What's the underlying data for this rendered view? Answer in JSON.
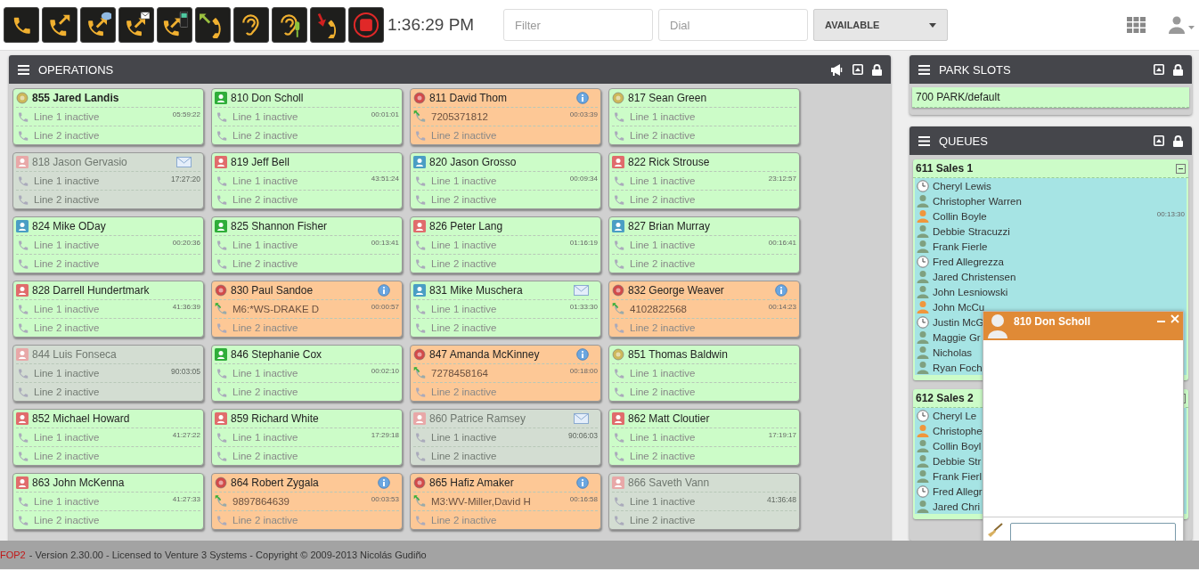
{
  "toolbar": {
    "clock": "1:36:29 PM",
    "filter": {
      "placeholder": "Filter"
    },
    "dial": {
      "placeholder": "Dial"
    },
    "presence": {
      "value": "AVAILABLE"
    }
  },
  "operations": {
    "title": "OPERATIONS",
    "extensions": [
      {
        "label": "855 Jared Landis",
        "kind": "available",
        "current_user": true,
        "icon": {
          "kind": "ring",
          "color": "#cdb85a"
        },
        "timer": "05:59:22",
        "lines": [
          {
            "text": "Line 1 inactive",
            "active": false
          },
          {
            "text": "Line 2 inactive",
            "active": false
          }
        ]
      },
      {
        "label": "810 Don Scholl",
        "kind": "available",
        "current_user": false,
        "icon": {
          "kind": "person",
          "color": "#2fae3a"
        },
        "timer": "00:01:01",
        "lines": [
          {
            "text": "Line 1 inactive",
            "active": false
          },
          {
            "text": "Line 2 inactive",
            "active": false
          }
        ]
      },
      {
        "label": "811 David Thom",
        "kind": "busy",
        "current_user": false,
        "icon": {
          "kind": "ring",
          "color": "#d24a4a"
        },
        "badge": {
          "kind": "info"
        },
        "timer": "00:03:39",
        "lines": [
          {
            "text": "7205371812",
            "active": true
          },
          {
            "text": "Line 2 inactive",
            "active": false
          }
        ]
      },
      {
        "label": "817 Sean Green",
        "kind": "available",
        "current_user": false,
        "icon": {
          "kind": "ring",
          "color": "#cdb85a"
        },
        "lines": [
          {
            "text": "Line 1 inactive",
            "active": false
          },
          {
            "text": "Line 2 inactive",
            "active": false
          }
        ]
      },
      {
        "label": "818 Jason Gervasio",
        "kind": "offline",
        "current_user": false,
        "icon": {
          "kind": "person",
          "color": "#e8a8a8"
        },
        "badge": {
          "kind": "mail"
        },
        "timer": "17:27:20",
        "lines": [
          {
            "text": "Line 1 inactive",
            "active": false
          },
          {
            "text": "Line 2 inactive",
            "active": false
          }
        ]
      },
      {
        "label": "819 Jeff Bell",
        "kind": "available",
        "current_user": false,
        "icon": {
          "kind": "person",
          "color": "#e06c6c"
        },
        "timer": "43:51:24",
        "lines": [
          {
            "text": "Line 1 inactive",
            "active": false
          },
          {
            "text": "Line 2 inactive",
            "active": false
          }
        ]
      },
      {
        "label": "820 Jason Grosso",
        "kind": "available",
        "current_user": false,
        "icon": {
          "kind": "person",
          "color": "#4a9ec4"
        },
        "timer": "00:09:34",
        "lines": [
          {
            "text": "Line 1 inactive",
            "active": false
          },
          {
            "text": "Line 2 inactive",
            "active": false
          }
        ]
      },
      {
        "label": "822 Rick Strouse",
        "kind": "available",
        "current_user": false,
        "icon": {
          "kind": "person",
          "color": "#e06c6c"
        },
        "timer": "23:12:57",
        "lines": [
          {
            "text": "Line 1 inactive",
            "active": false
          },
          {
            "text": "Line 2 inactive",
            "active": false
          }
        ]
      },
      {
        "label": "824 Mike ODay",
        "kind": "available",
        "current_user": false,
        "icon": {
          "kind": "person",
          "color": "#4a9ec4"
        },
        "timer": "00:20:36",
        "lines": [
          {
            "text": "Line 1 inactive",
            "active": false
          },
          {
            "text": "Line 2 inactive",
            "active": false
          }
        ]
      },
      {
        "label": "825 Shannon Fisher",
        "kind": "available",
        "current_user": false,
        "icon": {
          "kind": "person",
          "color": "#2fae3a"
        },
        "timer": "00:13:41",
        "lines": [
          {
            "text": "Line 1 inactive",
            "active": false
          },
          {
            "text": "Line 2 inactive",
            "active": false
          }
        ]
      },
      {
        "label": "826 Peter Lang",
        "kind": "available",
        "current_user": false,
        "icon": {
          "kind": "person",
          "color": "#e06c6c"
        },
        "timer": "01:16:19",
        "lines": [
          {
            "text": "Line 1 inactive",
            "active": false
          },
          {
            "text": "Line 2 inactive",
            "active": false
          }
        ]
      },
      {
        "label": "827 Brian Murray",
        "kind": "available",
        "current_user": false,
        "icon": {
          "kind": "person",
          "color": "#4a9ec4"
        },
        "timer": "00:16:41",
        "lines": [
          {
            "text": "Line 1 inactive",
            "active": false
          },
          {
            "text": "Line 2 inactive",
            "active": false
          }
        ]
      },
      {
        "label": "828 Darrell Hundertmark",
        "kind": "available",
        "current_user": false,
        "icon": {
          "kind": "person",
          "color": "#e06c6c"
        },
        "timer": "41:36:39",
        "lines": [
          {
            "text": "Line 1 inactive",
            "active": false
          },
          {
            "text": "Line 2 inactive",
            "active": false
          }
        ]
      },
      {
        "label": "830 Paul Sandoe",
        "kind": "busy",
        "current_user": false,
        "icon": {
          "kind": "ring",
          "color": "#d24a4a"
        },
        "badge": {
          "kind": "info"
        },
        "timer": "00:00:57",
        "lines": [
          {
            "text": "M6:*WS-DRAKE D",
            "active": true
          },
          {
            "text": "Line 2 inactive",
            "active": false
          }
        ]
      },
      {
        "label": "831 Mike Muschera",
        "kind": "available",
        "current_user": false,
        "icon": {
          "kind": "person",
          "color": "#4a9ec4"
        },
        "badge": {
          "kind": "mail"
        },
        "timer": "01:33:30",
        "lines": [
          {
            "text": "Line 1 inactive",
            "active": false
          },
          {
            "text": "Line 2 inactive",
            "active": false
          }
        ]
      },
      {
        "label": "832 George Weaver",
        "kind": "busy",
        "current_user": false,
        "icon": {
          "kind": "ring",
          "color": "#d24a4a"
        },
        "badge": {
          "kind": "info"
        },
        "timer": "00:14:23",
        "lines": [
          {
            "text": "4102822568",
            "active": true
          },
          {
            "text": "Line 2 inactive",
            "active": false
          }
        ]
      },
      {
        "label": "844 Luis Fonseca",
        "kind": "offline",
        "current_user": false,
        "icon": {
          "kind": "person",
          "color": "#e8a8a8"
        },
        "timer": "90:03:05",
        "lines": [
          {
            "text": "Line 1 inactive",
            "active": false
          },
          {
            "text": "Line 2 inactive",
            "active": false
          }
        ]
      },
      {
        "label": "846 Stephanie Cox",
        "kind": "available",
        "current_user": false,
        "icon": {
          "kind": "person",
          "color": "#2fae3a"
        },
        "timer": "00:02:10",
        "lines": [
          {
            "text": "Line 1 inactive",
            "active": false
          },
          {
            "text": "Line 2 inactive",
            "active": false
          }
        ]
      },
      {
        "label": "847 Amanda McKinney",
        "kind": "busy",
        "current_user": false,
        "icon": {
          "kind": "ring",
          "color": "#d24a4a"
        },
        "badge": {
          "kind": "info"
        },
        "timer": "00:18:00",
        "lines": [
          {
            "text": "7278458164",
            "active": true
          },
          {
            "text": "Line 2 inactive",
            "active": false
          }
        ]
      },
      {
        "label": "851 Thomas Baldwin",
        "kind": "available",
        "current_user": false,
        "icon": {
          "kind": "ring",
          "color": "#cdb85a"
        },
        "lines": [
          {
            "text": "Line 1 inactive",
            "active": false
          },
          {
            "text": "Line 2 inactive",
            "active": false
          }
        ]
      },
      {
        "label": "852 Michael Howard",
        "kind": "available",
        "current_user": false,
        "icon": {
          "kind": "person",
          "color": "#e06c6c"
        },
        "timer": "41:27:22",
        "lines": [
          {
            "text": "Line 1 inactive",
            "active": false
          },
          {
            "text": "Line 2 inactive",
            "active": false
          }
        ]
      },
      {
        "label": "859 Richard White",
        "kind": "available",
        "current_user": false,
        "icon": {
          "kind": "person",
          "color": "#e06c6c"
        },
        "timer": "17:29:18",
        "lines": [
          {
            "text": "Line 1 inactive",
            "active": false
          },
          {
            "text": "Line 2 inactive",
            "active": false
          }
        ]
      },
      {
        "label": "860 Patrice Ramsey",
        "kind": "offline",
        "current_user": false,
        "icon": {
          "kind": "person",
          "color": "#e8a8a8"
        },
        "badge": {
          "kind": "mail"
        },
        "timer": "90:06:03",
        "lines": [
          {
            "text": "Line 1 inactive",
            "active": false
          },
          {
            "text": "Line 2 inactive",
            "active": false
          }
        ]
      },
      {
        "label": "862 Matt Cloutier",
        "kind": "available",
        "current_user": false,
        "icon": {
          "kind": "person",
          "color": "#e06c6c"
        },
        "timer": "17:19:17",
        "lines": [
          {
            "text": "Line 1 inactive",
            "active": false
          },
          {
            "text": "Line 2 inactive",
            "active": false
          }
        ]
      },
      {
        "label": "863 John McKenna",
        "kind": "available",
        "current_user": false,
        "icon": {
          "kind": "person",
          "color": "#e06c6c"
        },
        "timer": "41:27:33",
        "lines": [
          {
            "text": "Line 1 inactive",
            "active": false
          },
          {
            "text": "Line 2 inactive",
            "active": false
          }
        ]
      },
      {
        "label": "864 Robert Zygala",
        "kind": "busy",
        "current_user": false,
        "icon": {
          "kind": "ring",
          "color": "#d24a4a"
        },
        "badge": {
          "kind": "info"
        },
        "timer": "00:03:53",
        "lines": [
          {
            "text": "9897864639",
            "active": true
          },
          {
            "text": "Line 2 inactive",
            "active": false
          }
        ]
      },
      {
        "label": "865 Hafiz Amaker",
        "kind": "busy",
        "current_user": false,
        "icon": {
          "kind": "ring",
          "color": "#d24a4a"
        },
        "badge": {
          "kind": "info"
        },
        "timer": "00:16:58",
        "lines": [
          {
            "text": "M3:WV-Miller,David H",
            "active": true
          },
          {
            "text": "Line 2 inactive",
            "active": false
          }
        ]
      },
      {
        "label": "866 Saveth Vann",
        "kind": "offline",
        "current_user": false,
        "icon": {
          "kind": "person",
          "color": "#e8a8a8"
        },
        "timer": "41:36:48",
        "lines": [
          {
            "text": "Line 1 inactive",
            "active": false
          },
          {
            "text": "Line 2 inactive",
            "active": false
          }
        ]
      }
    ]
  },
  "park_slots": {
    "title": "PARK SLOTS",
    "slots": [
      {
        "label": "700 PARK/default"
      }
    ]
  },
  "queues": {
    "title": "QUEUES",
    "queues": [
      {
        "name": "611 Sales 1",
        "expanded": true,
        "members": [
          {
            "name": "Cheryl Lewis",
            "kind": "clock"
          },
          {
            "name": "Christopher Warren",
            "kind": "person",
            "color": "#7fa07f"
          },
          {
            "name": "Collin Boyle",
            "kind": "person",
            "color": "#f0963c",
            "timer": "00:13:30"
          },
          {
            "name": "Debbie Stracuzzi",
            "kind": "person",
            "color": "#7fa07f"
          },
          {
            "name": "Frank Fierle",
            "kind": "person",
            "color": "#7fa07f"
          },
          {
            "name": "Fred Allegrezza",
            "kind": "clock"
          },
          {
            "name": "Jared Christensen",
            "kind": "person",
            "color": "#7fa07f"
          },
          {
            "name": "John Lesniowski",
            "kind": "person",
            "color": "#7fa07f"
          },
          {
            "name": "John McCu",
            "kind": "person",
            "color": "#f0963c"
          },
          {
            "name": "Justin McG",
            "kind": "clock"
          },
          {
            "name": "Maggie Gr",
            "kind": "person",
            "color": "#7fa07f"
          },
          {
            "name": "Nicholas",
            "kind": "person",
            "color": "#7fa07f"
          },
          {
            "name": "Ryan Foch",
            "kind": "person",
            "color": "#7fa07f"
          }
        ]
      },
      {
        "name": "612 Sales 2",
        "expanded": true,
        "members": [
          {
            "name": "Cheryl Le",
            "kind": "clock"
          },
          {
            "name": "Christophe",
            "kind": "person",
            "color": "#f0963c"
          },
          {
            "name": "Collin Boyl",
            "kind": "person",
            "color": "#7fa07f"
          },
          {
            "name": "Debbie Str",
            "kind": "person",
            "color": "#7fa07f"
          },
          {
            "name": "Frank Fierl",
            "kind": "person",
            "color": "#7fa07f"
          },
          {
            "name": "Fred Allegr",
            "kind": "clock"
          },
          {
            "name": "Jared Chri",
            "kind": "person",
            "color": "#7fa07f"
          }
        ]
      }
    ]
  },
  "chat": {
    "title": "810 Don Scholl"
  },
  "footer": {
    "product": "FOP2",
    "text": "- Version 2.30.00 - Licensed to Venture 3 Systems - Copyright © 2009-2013 Nicolás Gudiño"
  }
}
